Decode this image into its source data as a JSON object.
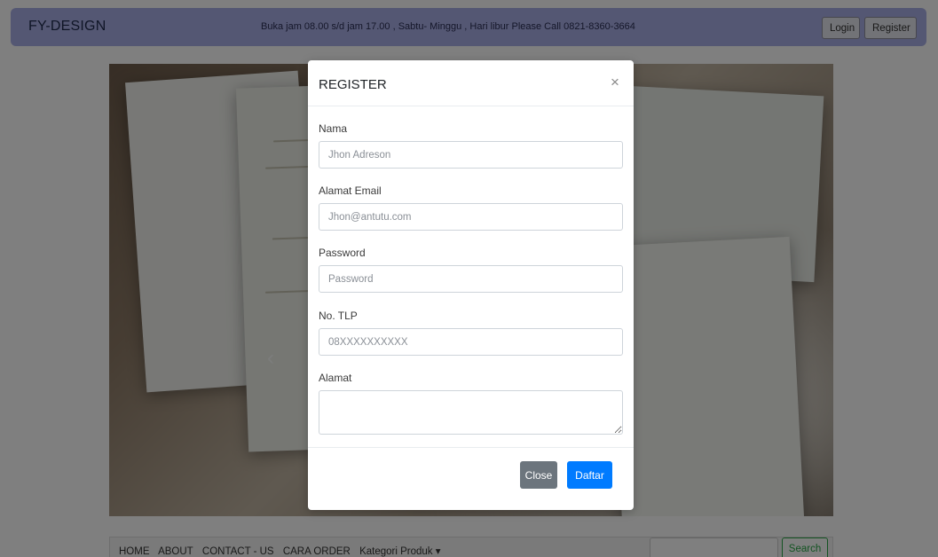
{
  "navbar": {
    "brand": "FY-DESIGN",
    "info": "Buka jam 08.00 s/d jam 17.00 , Sabtu- Minggu , Hari libur Please Call 0821-8360-3664",
    "login_label": "Login",
    "register_label": "Register"
  },
  "bottom_nav": {
    "links": [
      "HOME",
      "ABOUT",
      "CONTACT - US",
      "CARA ORDER",
      "Kategori Produk ▾"
    ],
    "search_label": "Search"
  },
  "modal": {
    "title": "REGISTER",
    "close_icon": "×",
    "fields": [
      {
        "label": "Nama",
        "placeholder": "Jhon Adreson"
      },
      {
        "label": "Alamat Email",
        "placeholder": "Jhon@antutu.com"
      },
      {
        "label": "Password",
        "placeholder": "Password"
      },
      {
        "label": "No. TLP",
        "placeholder": "08XXXXXXXXXX"
      },
      {
        "label": "Alamat",
        "placeholder": ""
      }
    ],
    "close_button": "Close",
    "submit_button": "Daftar"
  },
  "colors": {
    "navbar_bg": "#a9aee6",
    "primary": "#007bff",
    "secondary": "#6c757d",
    "success": "#28a745"
  }
}
